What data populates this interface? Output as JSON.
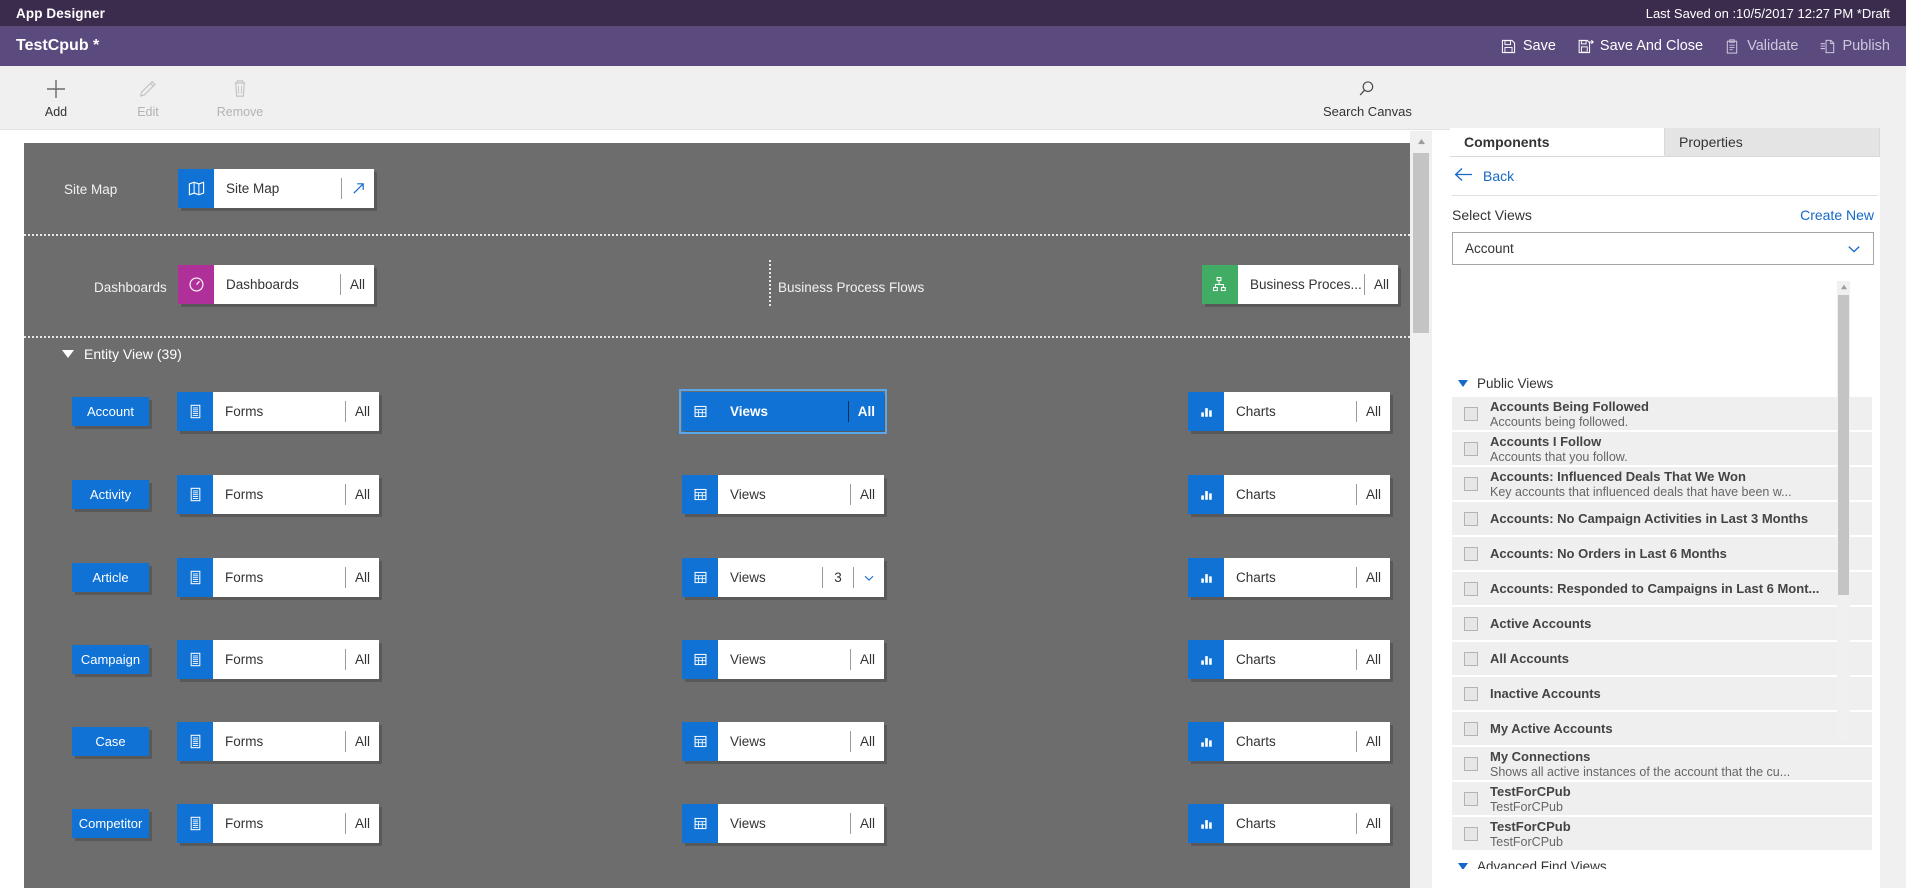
{
  "titlebar": {
    "app_title": "App Designer",
    "last_saved": "Last Saved on :10/5/2017 12:27 PM *Draft"
  },
  "commandbar": {
    "doc_title": "TestCpub *",
    "actions": [
      {
        "label": "Save",
        "icon": "save-icon",
        "enabled": true
      },
      {
        "label": "Save And Close",
        "icon": "save-and-close-icon",
        "enabled": true
      },
      {
        "label": "Validate",
        "icon": "validate-icon",
        "enabled": false
      },
      {
        "label": "Publish",
        "icon": "publish-icon",
        "enabled": false
      }
    ]
  },
  "ribbon": {
    "items": [
      {
        "label": "Add",
        "icon": "plus-icon",
        "enabled": true
      },
      {
        "label": "Edit",
        "icon": "pencil-icon",
        "enabled": false
      },
      {
        "label": "Remove",
        "icon": "trash-icon",
        "enabled": false
      }
    ],
    "search": {
      "label": "Search Canvas",
      "icon": "search-icon"
    }
  },
  "canvas": {
    "sitemap_band": {
      "label": "Site Map",
      "tile": {
        "name": "Site Map",
        "icon": "sitemap-icon",
        "icon_color": "#0f72d4",
        "action": "open-icon"
      }
    },
    "dashboards_band": {
      "label": "Dashboards",
      "tile": {
        "name": "Dashboards",
        "count": "All",
        "icon": "dashboard-icon",
        "icon_color": "#b0309a"
      }
    },
    "bpf_band": {
      "label": "Business Process Flows",
      "tile": {
        "name": "Business Proces...",
        "count": "All",
        "icon": "bpf-icon",
        "icon_color": "#41ad64"
      }
    },
    "entity_view": {
      "header": "Entity View (39)",
      "columns": [
        "Forms",
        "Views",
        "Charts"
      ],
      "rows": [
        {
          "entity": "Account",
          "forms": {
            "label": "Forms",
            "count": "All"
          },
          "views": {
            "label": "Views",
            "count": "All",
            "selected": true
          },
          "charts": {
            "label": "Charts",
            "count": "All"
          }
        },
        {
          "entity": "Activity",
          "forms": {
            "label": "Forms",
            "count": "All"
          },
          "views": {
            "label": "Views",
            "count": "All",
            "selected": false
          },
          "charts": {
            "label": "Charts",
            "count": "All"
          }
        },
        {
          "entity": "Article",
          "forms": {
            "label": "Forms",
            "count": "All"
          },
          "views": {
            "label": "Views",
            "count": "3",
            "selected": false,
            "has_chevron": true
          },
          "charts": {
            "label": "Charts",
            "count": "All"
          }
        },
        {
          "entity": "Campaign",
          "forms": {
            "label": "Forms",
            "count": "All"
          },
          "views": {
            "label": "Views",
            "count": "All",
            "selected": false
          },
          "charts": {
            "label": "Charts",
            "count": "All"
          }
        },
        {
          "entity": "Case",
          "forms": {
            "label": "Forms",
            "count": "All"
          },
          "views": {
            "label": "Views",
            "count": "All",
            "selected": false
          },
          "charts": {
            "label": "Charts",
            "count": "All"
          }
        },
        {
          "entity": "Competitor",
          "forms": {
            "label": "Forms",
            "count": "All"
          },
          "views": {
            "label": "Views",
            "count": "All",
            "selected": false
          },
          "charts": {
            "label": "Charts",
            "count": "All"
          }
        }
      ]
    }
  },
  "right_panel": {
    "tabs": [
      {
        "label": "Components",
        "active": true
      },
      {
        "label": "Properties",
        "active": false
      }
    ],
    "back_label": "Back",
    "select_views_label": "Select Views",
    "create_new_label": "Create New",
    "entity_select_value": "Account",
    "groups": [
      {
        "title": "Public Views",
        "expanded": true,
        "views": [
          {
            "title": "Accounts Being Followed",
            "subtitle": "Accounts being followed.",
            "checked": false
          },
          {
            "title": "Accounts I Follow",
            "subtitle": "Accounts that you follow.",
            "checked": false
          },
          {
            "title": "Accounts: Influenced Deals That We Won",
            "subtitle": "Key accounts that influenced deals that have been w...",
            "checked": false
          },
          {
            "title": "Accounts: No Campaign Activities in Last 3 Months",
            "subtitle": "",
            "checked": false
          },
          {
            "title": "Accounts: No Orders in Last 6 Months",
            "subtitle": "",
            "checked": false
          },
          {
            "title": "Accounts: Responded to Campaigns in Last 6 Mont...",
            "subtitle": "",
            "checked": false
          },
          {
            "title": "Active Accounts",
            "subtitle": "",
            "checked": false
          },
          {
            "title": "All Accounts",
            "subtitle": "",
            "checked": false
          },
          {
            "title": "Inactive Accounts",
            "subtitle": "",
            "checked": false
          },
          {
            "title": "My Active Accounts",
            "subtitle": "",
            "checked": false
          },
          {
            "title": "My Connections",
            "subtitle": "Shows all active instances of the account that the cu...",
            "checked": false
          },
          {
            "title": "TestForCPub",
            "subtitle": "TestForCPub",
            "checked": false
          },
          {
            "title": "TestForCPub",
            "subtitle": "TestForCPub",
            "checked": false
          }
        ]
      },
      {
        "title": "Advanced Find Views",
        "expanded": true,
        "views": []
      }
    ]
  },
  "colors": {
    "titlebar": "#3b2c4e",
    "commandbar": "#5b4a7e",
    "canvas": "#6d6d6d",
    "accent_blue": "#0f72d4",
    "link_blue": "#1569c7",
    "magenta": "#b0309a",
    "green": "#41ad64"
  }
}
